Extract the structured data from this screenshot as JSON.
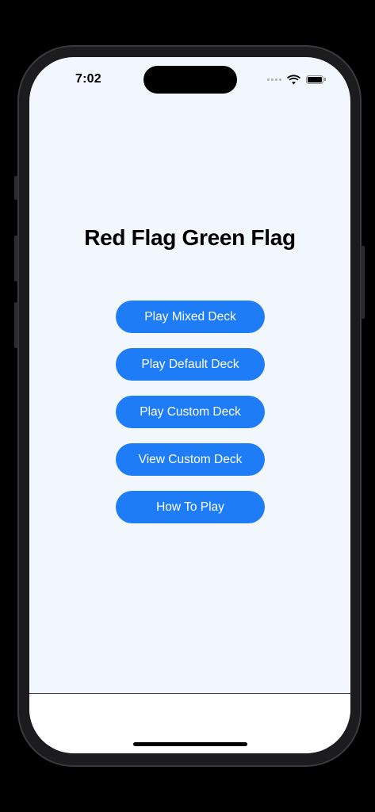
{
  "status_bar": {
    "time": "7:02",
    "icons": [
      "signal-dots-icon",
      "wifi-icon",
      "battery-icon"
    ]
  },
  "app": {
    "title": "Red Flag Green Flag",
    "accent_color": "#1f7cf7",
    "background_color": "#f1f7fc"
  },
  "menu": {
    "buttons": [
      {
        "label": "Play Mixed Deck"
      },
      {
        "label": "Play Default Deck"
      },
      {
        "label": "Play Custom Deck"
      },
      {
        "label": "View Custom Deck"
      },
      {
        "label": "How To Play"
      }
    ]
  }
}
